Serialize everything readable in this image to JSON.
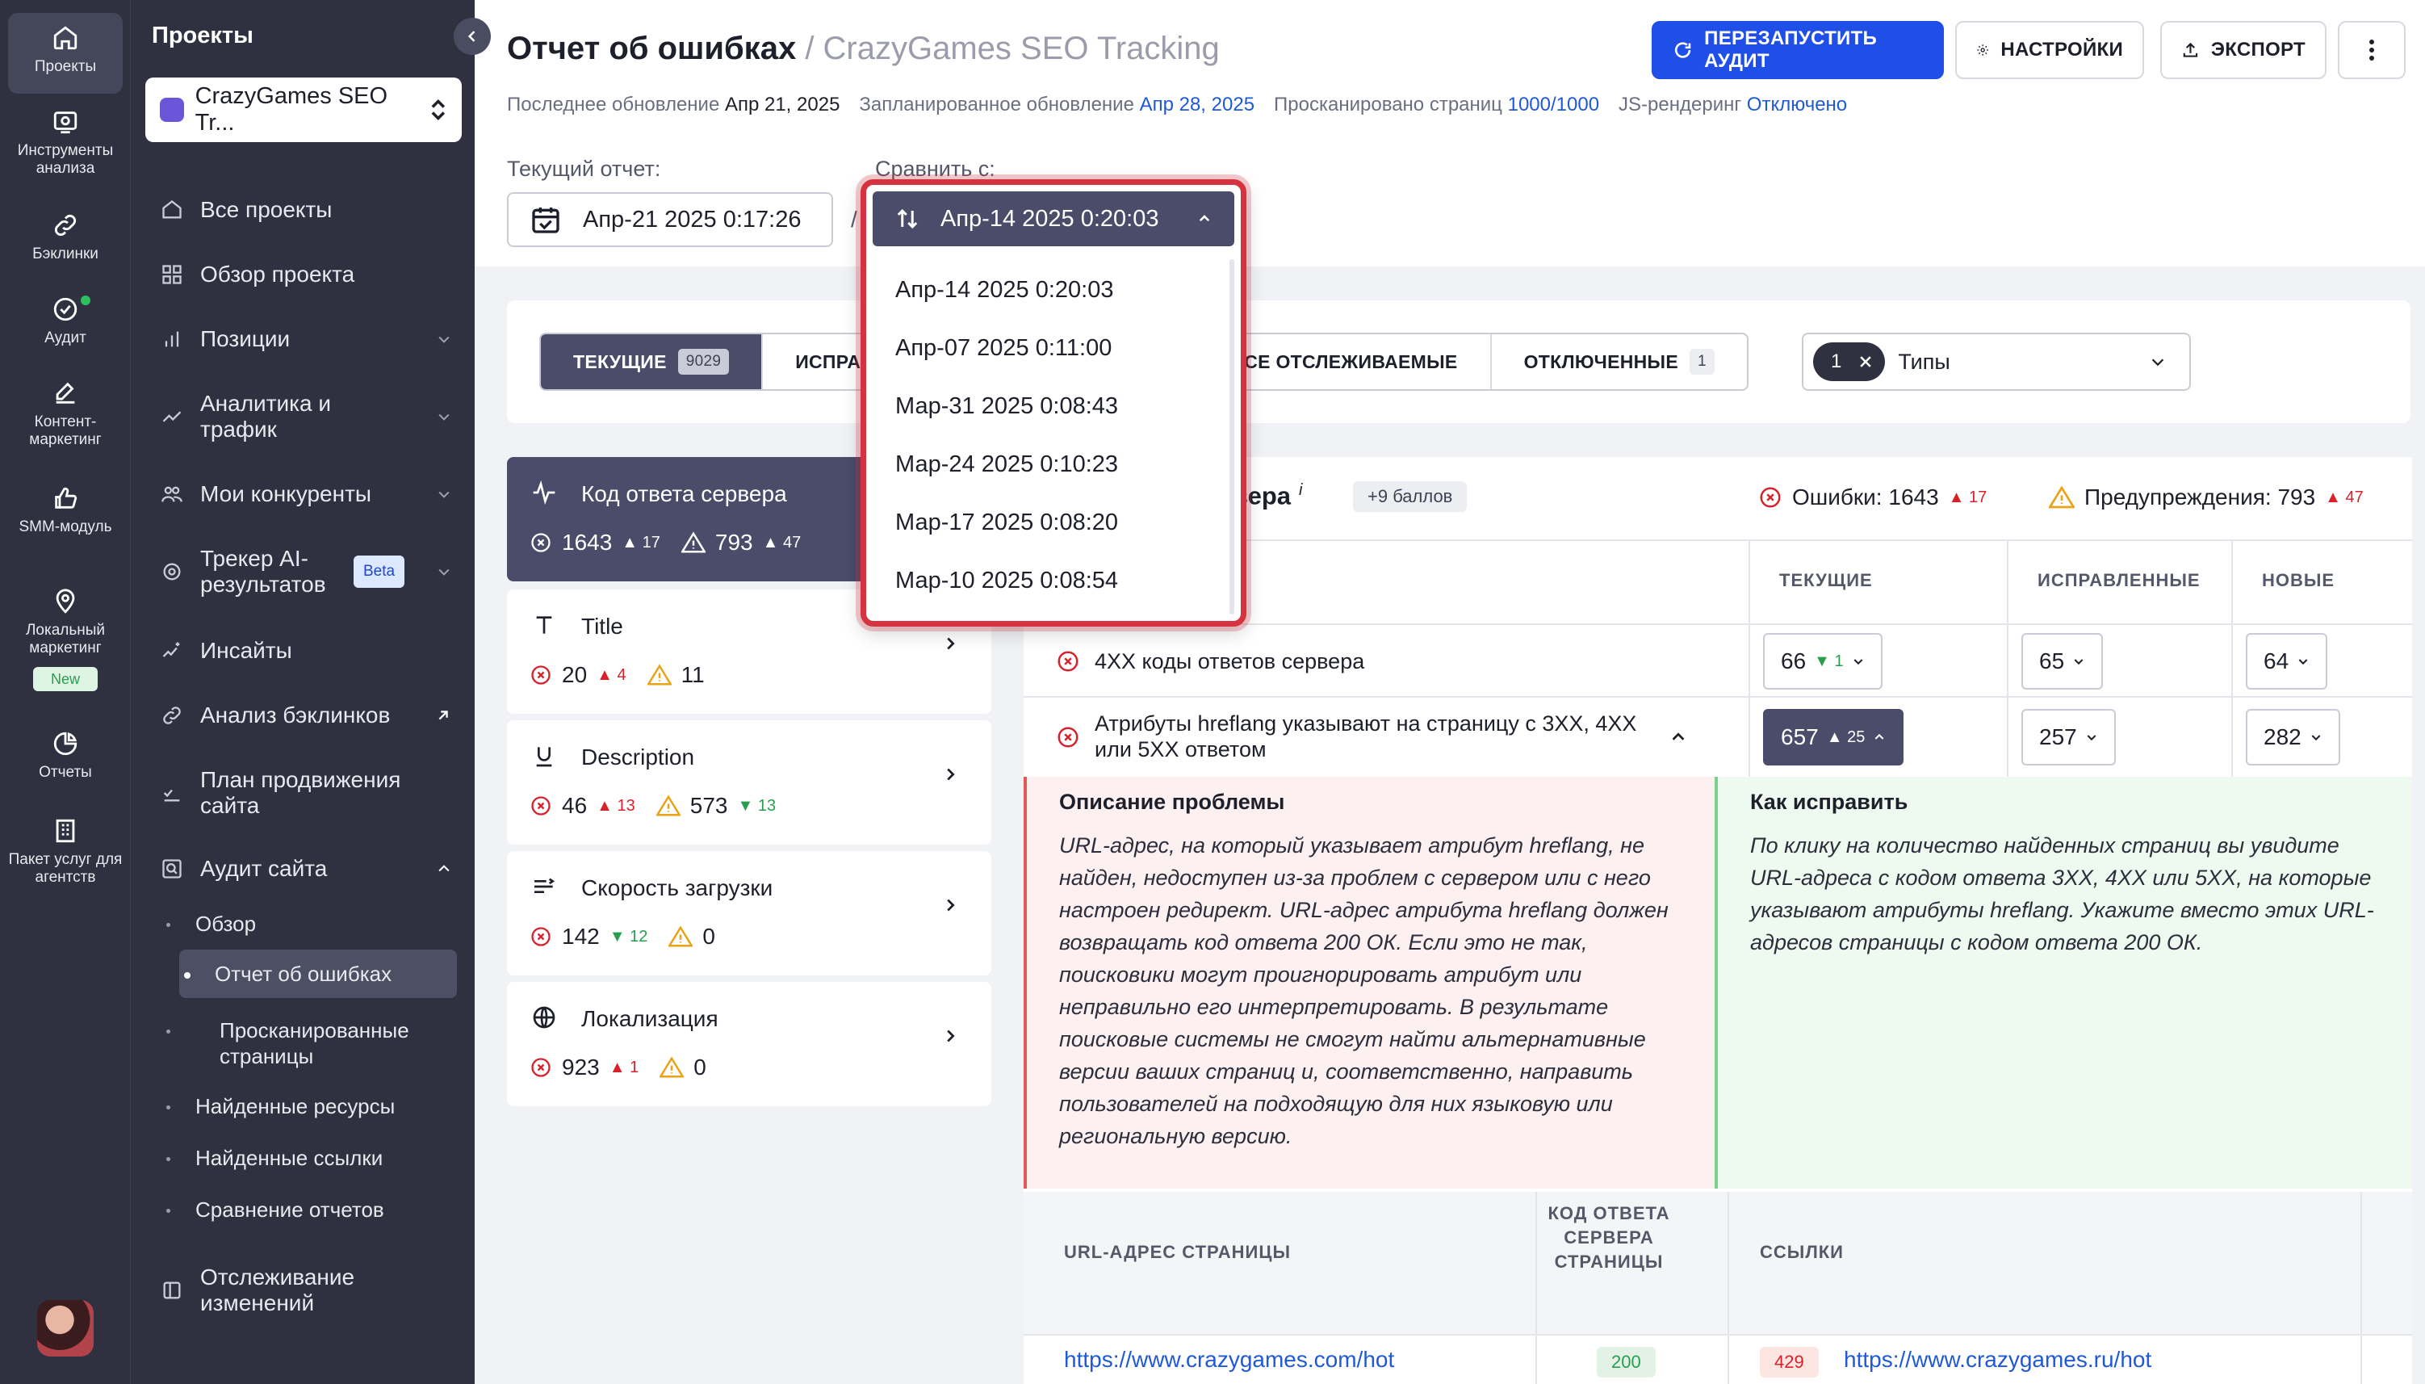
{
  "rail": {
    "items": [
      {
        "label": "Проекты",
        "icon": "home-icon"
      },
      {
        "label": "Инструменты анализа",
        "icon": "analysis-icon"
      },
      {
        "label": "Бэклинки",
        "icon": "link-icon"
      },
      {
        "label": "Аудит",
        "icon": "audit-check-icon"
      },
      {
        "label": "Контент-маркетинг",
        "icon": "edit-icon"
      },
      {
        "label": "SMM-модуль",
        "icon": "thumbs-up-icon"
      },
      {
        "label": "Локальный маркетинг",
        "icon": "map-pin-icon",
        "badge": "New"
      },
      {
        "label": "Отчеты",
        "icon": "pie-chart-icon"
      },
      {
        "label": "Пакет услуг для агентств",
        "icon": "building-icon"
      }
    ]
  },
  "sidebar": {
    "title": "Проекты",
    "project": "CrazyGames SEO Tr...",
    "nav": [
      {
        "label": "Все проекты"
      },
      {
        "label": "Обзор проекта"
      },
      {
        "label": "Позиции"
      },
      {
        "label": "Аналитика и трафик"
      },
      {
        "label": "Мои конкуренты"
      },
      {
        "label": "Трекер AI-результатов",
        "badge": "Beta"
      },
      {
        "label": "Инсайты"
      },
      {
        "label": "Анализ бэклинков"
      },
      {
        "label": "План продвижения сайта"
      },
      {
        "label": "Аудит сайта"
      }
    ],
    "audit_sub": [
      "Обзор",
      "Отчет об ошибках",
      "Просканированные страницы",
      "Найденные ресурсы",
      "Найденные ссылки",
      "Сравнение отчетов"
    ],
    "tracking": "Отслеживание изменений"
  },
  "header": {
    "title": "Отчет об ошибках",
    "project": "/ CrazyGames SEO Tracking",
    "meta": {
      "last_update_label": "Последнее обновление",
      "last_update": "Апр 21, 2025",
      "scheduled_label": "Запланированное обновление",
      "scheduled": "Апр 28, 2025",
      "scanned_label": "Просканировано страниц",
      "scanned": "1000/1000",
      "js_label": "JS-рендеринг",
      "js": "Отключено"
    },
    "buttons": {
      "restart": "ПЕРЕЗАПУСТИТЬ АУДИТ",
      "settings": "НАСТРОЙКИ",
      "export": "ЭКСПОРТ"
    },
    "current_report_label": "Текущий отчет:",
    "current_report": "Апр-21 2025 0:17:26",
    "compare_label": "Сравнить с:"
  },
  "compare_dropdown": {
    "selected": "Апр-14 2025 0:20:03",
    "options": [
      "Апр-14 2025 0:20:03",
      "Апр-07 2025 0:11:00",
      "Мар-31 2025 0:08:43",
      "Мар-24 2025 0:10:23",
      "Мар-17 2025 0:08:20",
      "Мар-10 2025 0:08:54"
    ]
  },
  "filters": {
    "tabs": [
      {
        "label": "ТЕКУЩИЕ",
        "count": "9029"
      },
      {
        "label": "ИСПРА"
      },
      {
        "label": "ВСЕ ОТСЛЕЖИВАЕМЫЕ"
      },
      {
        "label": "ОТКЛЮЧЕННЫЕ",
        "count": "1"
      }
    ],
    "types_count": "1",
    "types_label": "Типы"
  },
  "categories": [
    {
      "name": "Код ответа сервера",
      "errors": "1643",
      "errors_delta": "17",
      "warnings": "793",
      "warnings_delta": "47",
      "icon": "activity-icon"
    },
    {
      "name": "Title",
      "errors": "20",
      "errors_delta": "4",
      "warnings": "11",
      "icon": "title-t-icon"
    },
    {
      "name": "Description",
      "errors": "46",
      "errors_delta": "13",
      "warnings": "573",
      "warnings_delta": "13",
      "icon": "underline-icon"
    },
    {
      "name": "Скорость загрузки",
      "errors": "142",
      "errors_delta": "12",
      "warnings": "0",
      "icon": "speed-icon"
    },
    {
      "name": "Локализация",
      "errors": "923",
      "errors_delta": "1",
      "warnings": "0",
      "icon": "globe-icon"
    }
  ],
  "panel": {
    "title_tail": "рвера",
    "title_sup": "i",
    "points": "+9 баллов",
    "errors_label": "Ошибки: 1643",
    "errors_delta": "17",
    "warnings_label": "Предупреждения: 793",
    "warnings_delta": "47",
    "col_current": "ТЕКУЩИЕ",
    "col_fixed": "ИСПРАВЛЕННЫЕ",
    "col_new": "НОВЫЕ",
    "rows": [
      {
        "text": "4ХХ коды ответов сервера",
        "current": "66",
        "current_delta": "1",
        "fixed": "65",
        "new": "64"
      },
      {
        "text": "Атрибуты hreflang указывают на страницу с 3ХХ, 4ХХ или 5ХХ ответом",
        "current": "657",
        "current_delta": "25",
        "fixed": "257",
        "new": "282"
      }
    ],
    "problem_title": "Описание проблемы",
    "problem_text": "URL-адрес, на который указывает атрибут hreflang, не найден, недоступен из-за проблем с сервером или с него настроен редирект. URL-адрес атрибута hreflang должен возвращать код ответа 200 ОК. Если это не так, поисковики могут проигнорировать атрибут или неправильно его интерпретировать. В результате поисковые системы не смогут найти альтернативные версии ваших страниц и, соответственно, направить пользователей на подходящую для них языковую или региональную версию.",
    "fix_title": "Как исправить",
    "fix_text": "По клику на количество найденных страниц вы увидите URL-адреса с кодом ответа 3ХХ, 4ХХ или 5ХХ, на которые указывают атрибуты hreflang. Укажите вместо этих URL-адресов страницы с кодом ответа 200 ОК.",
    "url_col": "URL-АДРЕС СТРАНИЦЫ",
    "code_col": "КОД ОТВЕТА СЕРВЕРА СТРАНИЦЫ",
    "links_col": "ССЫЛКИ",
    "url_row": {
      "url": "https://www.crazygames.com/hot",
      "code": "200",
      "link_code": "429",
      "link": "https://www.crazygames.ru/hot"
    }
  },
  "colors": {
    "accent": "#1f4fe6",
    "error": "#d8222b",
    "warning": "#e8a317",
    "success": "#2b9d4f",
    "dark": "#2f3140",
    "highlight": "#d5333f"
  }
}
